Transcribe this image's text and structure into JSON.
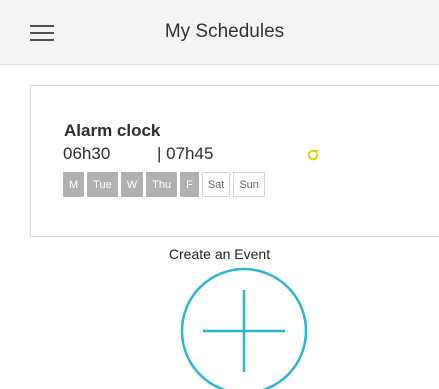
{
  "header": {
    "title": "My Schedules",
    "menu_icon": "hamburger-menu-icon"
  },
  "schedule": {
    "title": "Alarm clock",
    "start_time": "06h30",
    "end_time": "| 07h45",
    "repeat_icon": "repeat-icon",
    "repeat_color": "#e0d21a",
    "days": [
      {
        "label": "M",
        "active": true
      },
      {
        "label": "Tue",
        "active": true
      },
      {
        "label": "W",
        "active": true
      },
      {
        "label": "Thu",
        "active": true
      },
      {
        "label": "F",
        "active": true
      },
      {
        "label": "Sat",
        "active": false
      },
      {
        "label": "Sun",
        "active": false
      }
    ]
  },
  "create_event": {
    "label": "Create an Event",
    "icon": "plus-circle-icon",
    "accent_color": "#2bb6cf"
  }
}
